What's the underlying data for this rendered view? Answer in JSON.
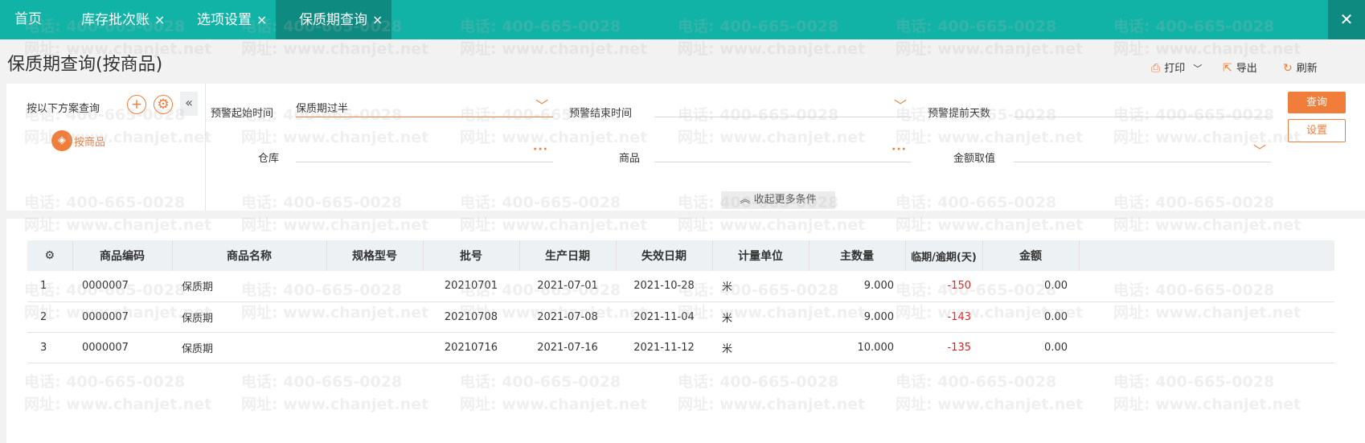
{
  "tabs": [
    {
      "label": "首页",
      "closable": false,
      "active": false
    },
    {
      "label": "库存批次账",
      "closable": true,
      "active": false
    },
    {
      "label": "选项设置",
      "closable": true,
      "active": false
    },
    {
      "label": "保质期查询",
      "closable": true,
      "active": true
    }
  ],
  "tab_close_glyph": "×",
  "window_close_glyph": "✕",
  "page_title": "保质期查询(按商品)",
  "actions": {
    "print": "打印",
    "export": "导出",
    "refresh": "刷新"
  },
  "scheme": {
    "title": "按以下方案查询",
    "item_label": "按商品"
  },
  "filters": {
    "alert_start_label": "预警起始时间",
    "alert_start_value": "保质期过半",
    "alert_end_label": "预警结束时间",
    "alert_end_value": "",
    "alert_days_label": "预警提前天数",
    "alert_days_value": "",
    "warehouse_label": "仓库",
    "warehouse_value": "",
    "product_label": "商品",
    "product_value": "",
    "amount_label": "金额取值",
    "amount_value": ""
  },
  "buttons": {
    "query": "查询",
    "settings": "设置",
    "collapse_more": "收起更多条件"
  },
  "table": {
    "columns": [
      "商品编码",
      "商品名称",
      "规格型号",
      "批号",
      "生产日期",
      "失效日期",
      "计量单位",
      "主数量",
      "临期/逾期(天)",
      "金额"
    ],
    "rows": [
      {
        "idx": "1",
        "code": "0000007",
        "name": "保质期",
        "spec": "",
        "batch": "20210701",
        "mfg": "2021-07-01",
        "exp": "2021-10-28",
        "unit": "米",
        "qty": "9.000",
        "days": "-150",
        "amount": "0.00"
      },
      {
        "idx": "2",
        "code": "0000007",
        "name": "保质期",
        "spec": "",
        "batch": "20210708",
        "mfg": "2021-07-08",
        "exp": "2021-11-04",
        "unit": "米",
        "qty": "9.000",
        "days": "-143",
        "amount": "0.00"
      },
      {
        "idx": "3",
        "code": "0000007",
        "name": "保质期",
        "spec": "",
        "batch": "20210716",
        "mfg": "2021-07-16",
        "exp": "2021-11-12",
        "unit": "米",
        "qty": "10.000",
        "days": "-135",
        "amount": "0.00"
      }
    ]
  },
  "watermark": {
    "phone": "电话: 400-665-0028",
    "site": "网址: www.chanjet.net"
  },
  "colors": {
    "tabbar": "#11b3a6",
    "tab_active": "#0e8a80",
    "accent": "#f07d3a",
    "overdue": "#e02020"
  }
}
